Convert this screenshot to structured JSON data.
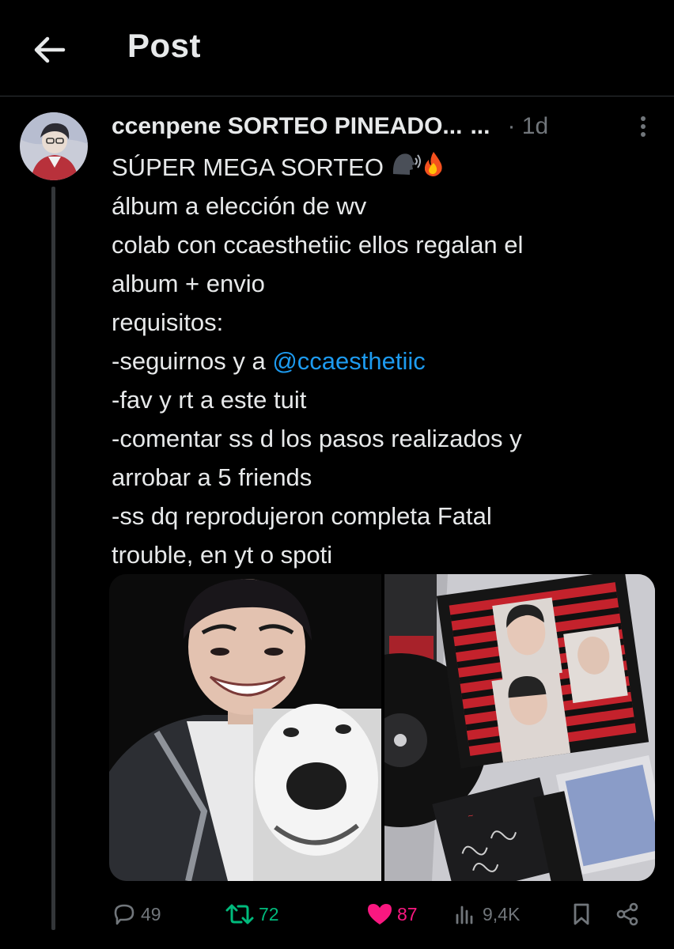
{
  "header": {
    "title": "Post",
    "back_icon": "arrow-left-icon"
  },
  "post": {
    "author_name": "ccenpene SORTEO PINEADO...",
    "author_suffix": "...",
    "separator": "·",
    "time": "1d",
    "lines": [
      "SÚPER MEGA SORTEO",
      "álbum a elección de wv",
      "colab con ccaesthetiic ellos regalan el",
      "album + envio",
      "requisitos:",
      "-seguirnos y a ",
      "-fav y rt a este tuit",
      "-comentar ss d los pasos realizados y",
      "arrobar a 5 friends",
      "-ss dq reprodujeron completa Fatal",
      "trouble, en yt o spoti"
    ],
    "mention": "@ccaesthetiic",
    "title_emojis": [
      "speaking-head-icon",
      "fire-icon"
    ]
  },
  "actions": {
    "replies": "49",
    "reposts": "72",
    "likes": "87",
    "views": "9,4K"
  },
  "colors": {
    "background": "#000000",
    "text": "#e7e9ea",
    "muted": "#71767b",
    "link": "#1d9bf0",
    "repost_active": "#00ba7c",
    "like_active": "#f91880",
    "divider": "#2f3336"
  }
}
